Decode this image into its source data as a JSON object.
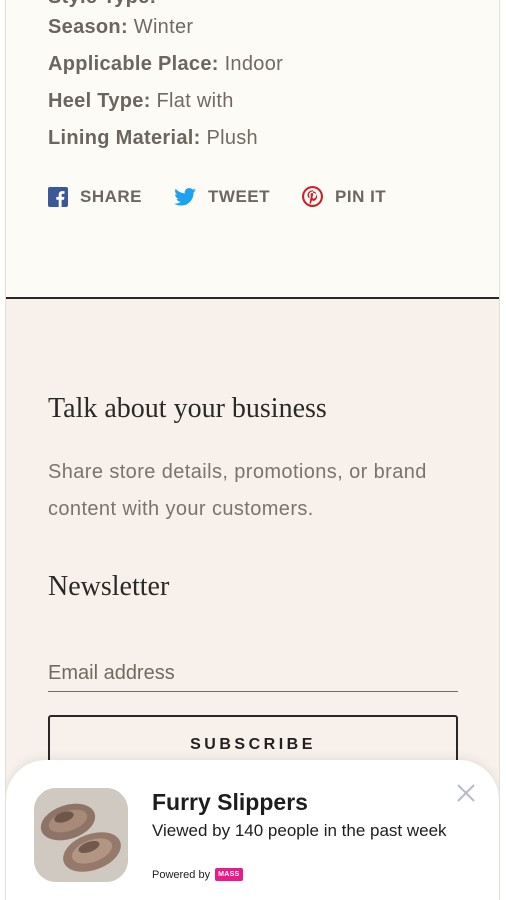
{
  "specs": [
    {
      "label": "Season:",
      "value": "Winter"
    },
    {
      "label": "Applicable Place:",
      "value": "Indoor"
    },
    {
      "label": "Heel Type:",
      "value": "Flat with"
    },
    {
      "label": "Lining Material:",
      "value": "Plush"
    }
  ],
  "social": {
    "share_label": "SHARE",
    "tweet_label": "TWEET",
    "pin_label": "PIN IT",
    "facebook_color": "#3b5998",
    "twitter_color": "#1da1f2",
    "pinterest_color": "#cb2027"
  },
  "footer": {
    "about_heading": "Talk about your business",
    "about_text": "Share store details, promotions, or brand content with your customers.",
    "newsletter_heading": "Newsletter",
    "email_placeholder": "Email address",
    "subscribe_label": "SUBSCRIBE"
  },
  "popup": {
    "product_name": "Furry Slippers",
    "viewed_text": "Viewed by 140 people in the past week",
    "powered_by": "Powered by",
    "brand_badge": "MASS",
    "close_icon": "close-icon"
  },
  "colors": {
    "product_bg": "#fdfbf6",
    "footer_bg": "#f8f1eb",
    "badge": "#e61c8c"
  }
}
